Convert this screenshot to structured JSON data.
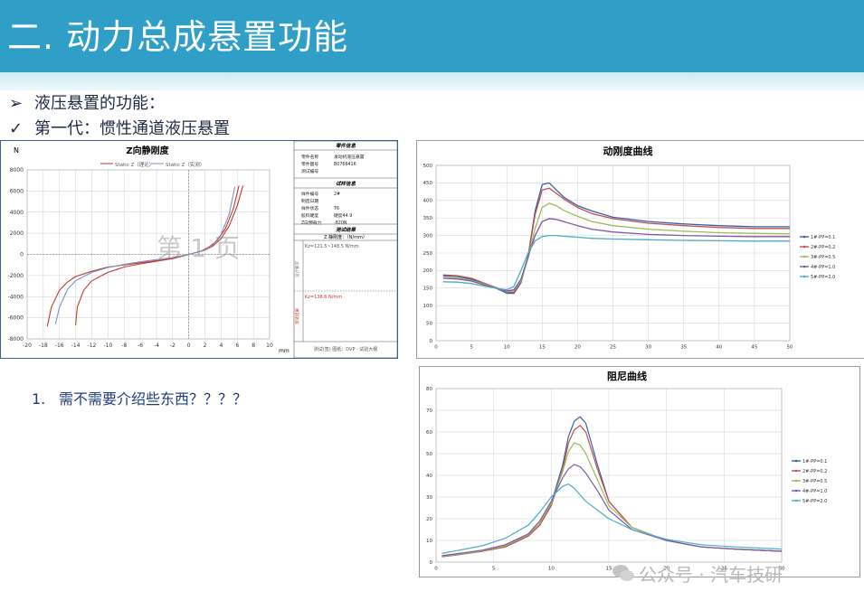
{
  "header": {
    "title": "二. 动力总成悬置功能"
  },
  "bullets": [
    {
      "marker": "➢",
      "text": "液压悬置的功能："
    },
    {
      "marker": "✓",
      "text": "第一代：惯性通道液压悬置"
    }
  ],
  "note": {
    "number": "1.",
    "text": "需不需要介绍些东西？？？？"
  },
  "static_chart": {
    "ylabel": "N",
    "title": "Z向静刚度",
    "xunit": "mm",
    "page_stamp": "第 1 页",
    "legend": [
      "Static Z（理论）",
      "Static Z（实测）"
    ],
    "info": {
      "part_header": "零件信息",
      "part_rows": [
        [
          "零件名称",
          "发动机液压悬置"
        ],
        [
          "零件图号",
          "B0766416"
        ],
        [
          "测试编号",
          ""
        ]
      ],
      "sample_header": "试样信息",
      "sample_rows": [
        [
          "样件编号",
          "2#"
        ],
        [
          "制造日期",
          ""
        ],
        [
          "样件状态",
          "T6"
        ],
        [
          "胶料硬度",
          "硬度44.9"
        ],
        [
          "Z向预载力",
          "-820N"
        ]
      ],
      "result_header": "测试结果",
      "stiffness_title": "Z 静刚度：（N/mm）",
      "spec_label": "设计要求",
      "spec_value": "Kz=121.5~148.5 N/mm",
      "measured_label": "测试结果",
      "measured_value": "Kz=136.6 N/mm",
      "footer": "测试(签)  图纸：DVP · 试验大纲"
    }
  },
  "chart_data": [
    {
      "type": "line",
      "title": "Z向静刚度",
      "xlabel": "mm",
      "ylabel": "N",
      "xlim": [
        -20,
        10
      ],
      "ylim": [
        -8000,
        8000
      ],
      "xticks": [
        -20,
        -18,
        -16,
        -14,
        -12,
        -10,
        -8,
        -6,
        -4,
        -2,
        0,
        2,
        4,
        6,
        8,
        10
      ],
      "yticks": [
        -8000,
        -6000,
        -4000,
        -2000,
        0,
        2000,
        4000,
        6000,
        8000
      ],
      "grid": true,
      "legend_position": "top",
      "series": [
        {
          "name": "Static Z（理论）",
          "color": "#c0392b",
          "x": [
            -17.5,
            -17.0,
            -16.0,
            -15.0,
            -14.0,
            -12.0,
            -10.0,
            -8.0,
            -6.0,
            -4.0,
            -2.0,
            0.0,
            1.5,
            2.5,
            3.5,
            4.5,
            5.5,
            6.2
          ],
          "y": [
            -6800,
            -5000,
            -3400,
            -2600,
            -2100,
            -1600,
            -1200,
            -1000,
            -800,
            -600,
            -400,
            0,
            300,
            700,
            1300,
            2400,
            4300,
            6500
          ]
        },
        {
          "name": "Static Z（理论）",
          "color": "#c0392b",
          "x": [
            -14.0,
            -13.8,
            -13.0,
            -12.0,
            -10.0,
            -8.0,
            -6.0,
            -4.0,
            -2.0,
            0.0,
            2.0,
            3.0,
            4.0,
            5.0,
            6.0,
            6.7
          ],
          "y": [
            -6700,
            -5000,
            -3400,
            -2500,
            -1700,
            -1200,
            -900,
            -650,
            -400,
            0,
            400,
            800,
            1500,
            2700,
            4600,
            6500
          ]
        },
        {
          "name": "Static Z（实测）",
          "color": "#7f8fd0",
          "x": [
            -16.5,
            -16.0,
            -15.0,
            -14.0,
            -12.0,
            -10.0,
            -8.0,
            -6.0,
            -4.0,
            -2.0,
            0.0,
            2.0,
            3.0,
            4.0,
            5.0,
            5.7
          ],
          "y": [
            -6600,
            -5000,
            -3300,
            -2500,
            -1700,
            -1250,
            -950,
            -700,
            -500,
            -300,
            0,
            400,
            900,
            1900,
            3800,
            6400
          ]
        }
      ]
    },
    {
      "type": "line",
      "title": "动刚度曲线",
      "xlim": [
        0,
        50
      ],
      "ylim": [
        0,
        500
      ],
      "xticks": [
        0,
        5,
        10,
        15,
        20,
        25,
        30,
        35,
        40,
        45,
        50
      ],
      "yticks": [
        0,
        50,
        100,
        150,
        200,
        250,
        300,
        350,
        400,
        450,
        500
      ],
      "grid": true,
      "legend_position": "right",
      "x": [
        1,
        3,
        5,
        7,
        9,
        10,
        11,
        12,
        13,
        14,
        15,
        16,
        17,
        18,
        20,
        22,
        25,
        30,
        35,
        40,
        45,
        50
      ],
      "series": [
        {
          "name": "1#-PP=0.1",
          "color": "#3a5da8",
          "values": [
            185,
            183,
            175,
            160,
            145,
            135,
            135,
            165,
            240,
            370,
            445,
            450,
            430,
            410,
            385,
            370,
            352,
            340,
            333,
            328,
            325,
            325
          ]
        },
        {
          "name": "2#-PP=0.2",
          "color": "#c0504d",
          "values": [
            188,
            185,
            178,
            163,
            148,
            138,
            138,
            168,
            240,
            360,
            430,
            435,
            420,
            405,
            380,
            363,
            348,
            335,
            328,
            323,
            320,
            320
          ]
        },
        {
          "name": "3#-PP=0.5",
          "color": "#9bbb59",
          "values": [
            180,
            178,
            172,
            160,
            148,
            140,
            142,
            170,
            235,
            320,
            380,
            392,
            385,
            372,
            355,
            340,
            328,
            318,
            312,
            308,
            306,
            305
          ]
        },
        {
          "name": "4#-PP=1.0",
          "color": "#7a58a8",
          "values": [
            178,
            176,
            170,
            158,
            148,
            142,
            145,
            175,
            240,
            300,
            340,
            348,
            346,
            340,
            328,
            318,
            310,
            303,
            300,
            298,
            297,
            297
          ]
        },
        {
          "name": "5#-PP=2.0",
          "color": "#4bacc6",
          "values": [
            168,
            167,
            163,
            155,
            148,
            145,
            155,
            200,
            250,
            285,
            297,
            300,
            300,
            298,
            295,
            292,
            290,
            288,
            286,
            285,
            284,
            284
          ]
        }
      ]
    },
    {
      "type": "line",
      "title": "阻尼曲线",
      "xlim": [
        0,
        30
      ],
      "ylim": [
        0,
        80
      ],
      "xticks": [
        0,
        5,
        10,
        15,
        20,
        25,
        30
      ],
      "yticks": [
        0,
        10,
        20,
        30,
        40,
        50,
        60,
        70,
        80
      ],
      "grid": true,
      "legend_position": "right",
      "x": [
        0.5,
        2,
        4,
        6,
        8,
        9,
        10,
        11,
        11.5,
        12,
        12.5,
        13,
        14,
        15,
        17,
        20,
        23,
        26,
        30
      ],
      "series": [
        {
          "name": "1#-PP=0.1",
          "color": "#3a5da8",
          "values": [
            2.5,
            3.5,
            5,
            7,
            12,
            17,
            27,
            45,
            58,
            65,
            67,
            64,
            45,
            28,
            16,
            10,
            7,
            6,
            5
          ]
        },
        {
          "name": "2#-PP=0.2",
          "color": "#c0504d",
          "values": [
            2.5,
            3.5,
            5,
            7,
            12,
            17,
            26,
            43,
            55,
            61,
            63,
            60,
            43,
            28,
            16,
            10,
            7,
            6,
            5
          ]
        },
        {
          "name": "3#-PP=0.5",
          "color": "#9bbb59",
          "values": [
            2.7,
            3.7,
            5.2,
            7.5,
            12.5,
            18,
            27,
            42,
            51,
            55,
            54,
            50,
            38,
            26,
            16,
            10,
            7,
            6,
            5
          ]
        },
        {
          "name": "4#-PP=1.0",
          "color": "#7a58a8",
          "values": [
            3,
            4,
            5.5,
            8,
            13,
            19,
            28,
            39,
            43,
            45,
            44,
            41,
            33,
            24,
            15,
            10,
            7,
            6,
            5
          ]
        },
        {
          "name": "5#-PP=2.0",
          "color": "#4bacc6",
          "values": [
            4,
            5.5,
            7.5,
            11,
            17,
            23,
            30,
            35,
            36,
            34,
            31,
            28,
            24,
            20,
            15,
            10.5,
            8,
            7,
            6
          ]
        }
      ]
    }
  ],
  "watermark": {
    "text": "公众号 · 汽车技研"
  }
}
